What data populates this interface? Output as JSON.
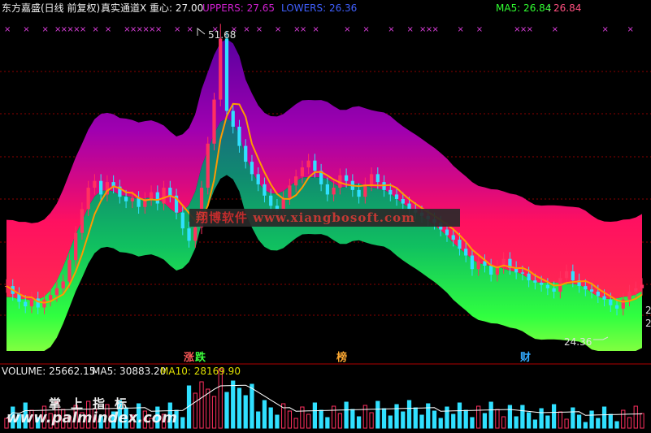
{
  "header": {
    "title": "东方嘉盛(日线 前复权)",
    "indicator_name": "真实通道X",
    "center_label": "重心: 27.00",
    "uppers_label": "UPPERS: 27.65",
    "lowers_label": "LOWERS: 26.36",
    "ma5_label": "MA5: 26.84",
    "ma5_value2": "26.84"
  },
  "price_chart": {
    "high_label": "51.68",
    "low_label": "24.36",
    "right_edge_labels": [
      "2",
      "2"
    ],
    "event_tags": [
      {
        "text": "涨",
        "color": "#ff5a5a"
      },
      {
        "text": "跌",
        "color": "#3cff3c"
      },
      {
        "text": "榜",
        "color": "#ffaa33"
      },
      {
        "text": "财",
        "color": "#33aaff"
      }
    ]
  },
  "volume_panel": {
    "volume_label": "VOLUME: 25662.15",
    "ma5_label": "MA5: 30883.20",
    "ma10_label": "MA10: 28169.90"
  },
  "watermarks": {
    "center": "翔博软件 www.xiangbosoft.com",
    "bottom_cn": "掌上指标",
    "bottom_url": "www.palmindex.com"
  },
  "colors": {
    "up": "#ff3060",
    "down": "#30e0ff",
    "ma_line": "#ff9a00",
    "uppers": "#c000c0",
    "lowers": "#4060ff",
    "ma5": "#30ff30",
    "marker": "#e040e0"
  },
  "chart_data": {
    "type": "candlestick",
    "price_high": 51.68,
    "price_low": 24.36,
    "close": [
      29.1,
      28.4,
      27.7,
      27.3,
      28.0,
      27.2,
      27.9,
      28.3,
      28.9,
      29.5,
      31.4,
      33.8,
      35.9,
      37.8,
      38.4,
      37.2,
      38.3,
      37.9,
      37.0,
      36.6,
      36.9,
      36.1,
      36.8,
      37.4,
      36.4,
      37.8,
      37.1,
      35.6,
      34.2,
      33.1,
      34.3,
      37.8,
      41.7,
      45.6,
      51.0,
      44.6,
      43.2,
      41.5,
      40.1,
      39.0,
      38.1,
      37.1,
      36.2,
      35.8,
      36.9,
      38.0,
      38.8,
      39.6,
      40.2,
      39.3,
      38.1,
      37.2,
      37.8,
      38.9,
      38.4,
      37.6,
      37.0,
      38.1,
      39.0,
      38.3,
      37.6,
      37.2,
      36.8,
      36.4,
      35.9,
      35.6,
      35.3,
      35.0,
      34.7,
      34.1,
      33.6,
      33.2,
      32.4,
      31.8,
      30.6,
      31.3,
      30.9,
      30.1,
      30.8,
      31.5,
      30.7,
      30.3,
      30.2,
      29.6,
      29.4,
      29.2,
      28.9,
      28.6,
      29.8,
      30.4,
      29.6,
      29.1,
      28.8,
      28.6,
      28.2,
      27.9,
      27.4,
      27.1,
      27.9,
      28.6,
      28.9,
      29.2
    ]
  }
}
